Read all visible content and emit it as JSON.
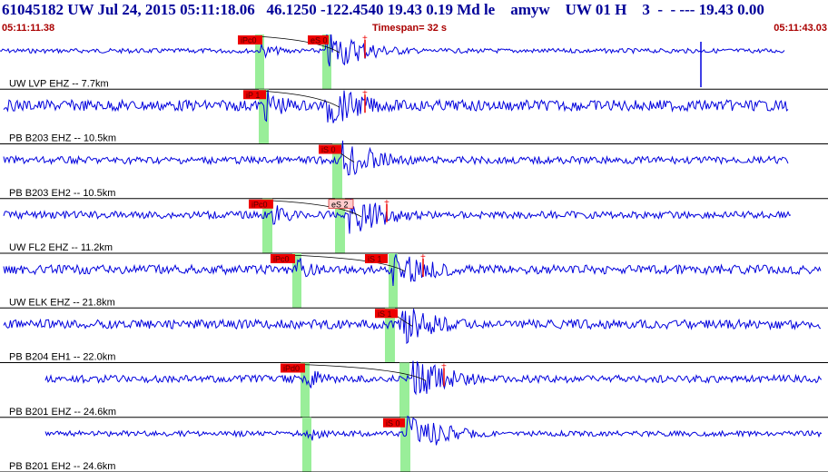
{
  "header": {
    "title": "61045182 UW Jul 24, 2015 05:11:18.06   46.1250 -122.4540 19.43 0.19 Md le    amyw    UW 01 H    3  -  - --- 19.43 0.00",
    "start_time": "05:11:11.38",
    "timespan": "Timespan=  32 s",
    "end_time": "05:11:43.03"
  },
  "colors": {
    "trace": "#0000dd",
    "pick_box": "#ee0000",
    "pick_box_weak": "#ffcccc",
    "pick_text": "#550000",
    "green_band": "#99ee99",
    "divider": "#000000",
    "header": "#000099",
    "time_label": "#aa0000"
  },
  "channels": [
    {
      "label": "UW LVP EHZ -- 7.7km",
      "picks": [
        {
          "text": "iPc0"
        },
        {
          "text": "eS 0"
        }
      ]
    },
    {
      "label": "PB B203 EHZ -- 10.5km",
      "picks": [
        {
          "text": "iP 1"
        }
      ]
    },
    {
      "label": "PB B203 EH2 -- 10.5km",
      "picks": [
        {
          "text": "iS 0"
        }
      ]
    },
    {
      "label": "UW FL2 EHZ -- 11.2km",
      "picks": [
        {
          "text": "iPc0"
        },
        {
          "text": "eS 2"
        }
      ]
    },
    {
      "label": "UW ELK EHZ -- 21.8km",
      "picks": [
        {
          "text": "iPc0"
        },
        {
          "text": "iS 1"
        }
      ]
    },
    {
      "label": "PB B204 EH1 -- 22.0km",
      "picks": [
        {
          "text": "iS 1"
        }
      ]
    },
    {
      "label": "PB B201 EHZ -- 24.6km",
      "picks": [
        {
          "text": "iPd0"
        }
      ]
    },
    {
      "label": "PB B201 EH2 -- 24.6km",
      "picks": [
        {
          "text": "iS 0"
        }
      ]
    }
  ]
}
